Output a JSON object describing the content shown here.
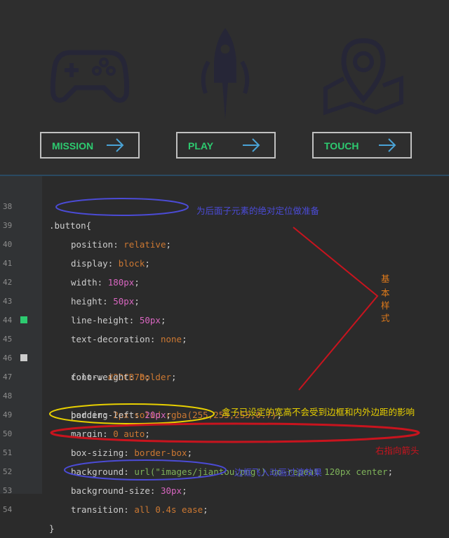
{
  "demo": {
    "buttons": [
      {
        "label": "MISSION",
        "icon": "arrow-right-icon"
      },
      {
        "label": "PLAY",
        "icon": "arrow-right-icon"
      },
      {
        "label": "TOUCH",
        "icon": "arrow-right-icon"
      }
    ],
    "icons": [
      "gamepad-icon",
      "rocket-icon",
      "map-pin-icon"
    ]
  },
  "code": {
    "lines": [
      {
        "num": "38",
        "text": ".button{"
      },
      {
        "num": "39",
        "prop": "position",
        "value": "relative"
      },
      {
        "num": "40",
        "prop": "display",
        "value": "block"
      },
      {
        "num": "41",
        "prop": "width",
        "value": "180px"
      },
      {
        "num": "42",
        "prop": "height",
        "value": "50px"
      },
      {
        "num": "43",
        "prop": "line-height",
        "value": "50px"
      },
      {
        "num": "44",
        "prop": "text-decoration",
        "value": "none"
      },
      {
        "num": "45",
        "prop": "color",
        "value": "#2DCB70"
      },
      {
        "num": "46",
        "prop": "font-weight",
        "value": "bolder"
      },
      {
        "num": "47",
        "prop": "border",
        "value": "2px solid rgba(255,255,255,0.7)"
      },
      {
        "num": "48",
        "prop": "padding-left",
        "value": "20px"
      },
      {
        "num": "49",
        "prop": "margin",
        "value": "0 auto"
      },
      {
        "num": "50",
        "prop": "box-sizing",
        "value": "border-box"
      },
      {
        "num": "51",
        "prop": "background",
        "value": "url(\"images/jiantou.png\") no-repeat 120px center"
      },
      {
        "num": "52",
        "prop": "background-size",
        "value": "30px"
      },
      {
        "num": "53",
        "prop": "transition",
        "value": "all 0.4s ease"
      },
      {
        "num": "54",
        "text": "}"
      }
    ],
    "swatches": {
      "line45": "#2DCB70",
      "line47": "#cccccc"
    }
  },
  "annotations": {
    "position_note": "为后面子元素的绝对定位做准备",
    "basic_style": [
      "基",
      "本",
      "样",
      "式"
    ],
    "box_sizing_note": "盒子已设定的宽高不会受到边框和内外边距的影响",
    "arrow_note": "右指向箭头",
    "transition_note": "边框飞入动画过渡效果"
  },
  "colors": {
    "accent": "#2DCB70",
    "blue_ellipse": "#4b4bd6",
    "yellow_ellipse": "#e8d000",
    "red_ellipse": "#c8141e"
  }
}
